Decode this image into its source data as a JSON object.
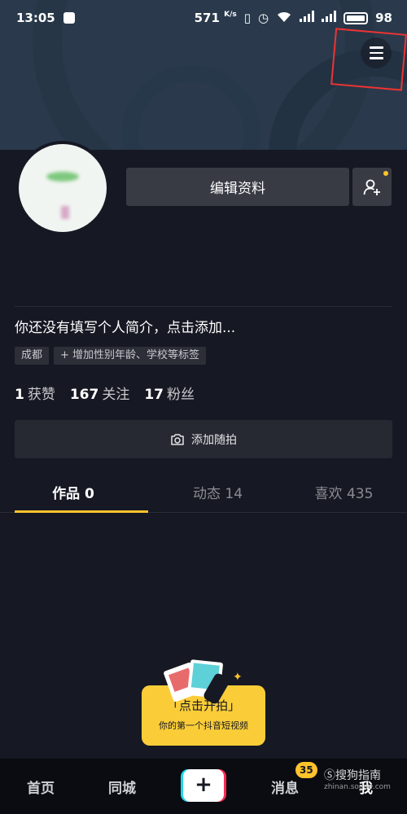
{
  "status_bar": {
    "time": "13:05",
    "speed": "571",
    "speed_unit": "K/s",
    "battery": "98"
  },
  "profile": {
    "edit_label": "编辑资料",
    "bio": "你还没有填写个人简介，点击添加...",
    "tags": [
      "成都",
      "+ 增加性别年龄、学校等标签"
    ],
    "stats": [
      {
        "value": "1",
        "label": "获赞"
      },
      {
        "value": "167",
        "label": "关注"
      },
      {
        "value": "17",
        "label": "粉丝"
      }
    ],
    "random_shot_label": "添加随拍"
  },
  "tabs": [
    {
      "label": "作品 0",
      "active": true
    },
    {
      "label": "动态 14",
      "active": false
    },
    {
      "label": "喜欢 435",
      "active": false
    }
  ],
  "start_card": {
    "title": "「点击开拍」",
    "subtitle": "你的第一个抖音短视频"
  },
  "bottom_nav": {
    "home": "首页",
    "city": "同城",
    "plus": "+",
    "messages": "消息",
    "messages_badge": "35",
    "me": "我"
  },
  "watermark": {
    "line1": "Ⓢ搜狗指南",
    "line2": "zhinan.sogou.com"
  },
  "colors": {
    "accent": "#ffc32b",
    "background": "#161823",
    "cover": "#2a3a4c"
  }
}
